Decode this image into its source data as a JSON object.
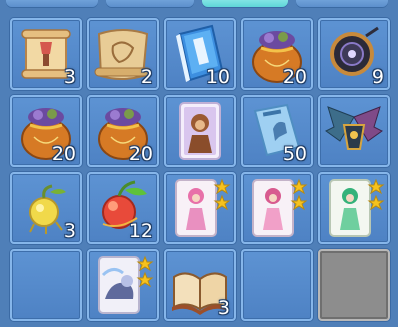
{
  "inventory": {
    "rows": [
      [
        {
          "name": "scroll-brush",
          "count": "3"
        },
        {
          "name": "map-scroll",
          "count": "2"
        },
        {
          "name": "blue-book",
          "count": "10"
        },
        {
          "name": "treasure-bag",
          "count": "20"
        },
        {
          "name": "dark-orb",
          "count": "9"
        }
      ],
      [
        {
          "name": "treasure-bag",
          "count": "20"
        },
        {
          "name": "treasure-bag",
          "count": "20"
        },
        {
          "name": "monkey-card",
          "count": ""
        },
        {
          "name": "horse-manual",
          "count": "50"
        },
        {
          "name": "winged-armor",
          "count": ""
        }
      ],
      [
        {
          "name": "golden-gourd",
          "count": "3"
        },
        {
          "name": "lucky-fruit",
          "count": "12"
        },
        {
          "name": "pink-hair-character-card",
          "count": ""
        },
        {
          "name": "pink-girl-character-card",
          "count": ""
        },
        {
          "name": "green-hair-character-card",
          "count": ""
        }
      ],
      [
        {
          "name": "empty-slot",
          "count": ""
        },
        {
          "name": "wolf-character-card",
          "count": ""
        },
        {
          "name": "open-book",
          "count": "3"
        },
        {
          "name": "empty-slot",
          "count": ""
        },
        {
          "name": "locked-slot",
          "count": ""
        }
      ]
    ]
  }
}
